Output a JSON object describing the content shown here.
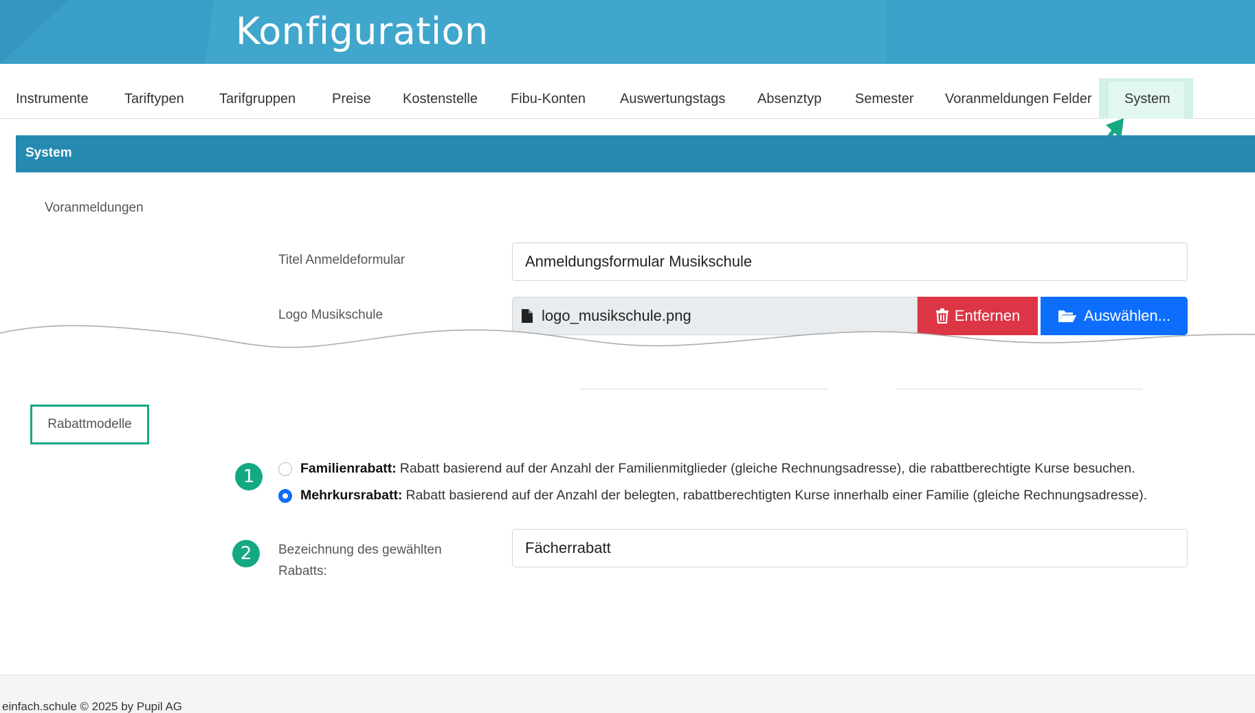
{
  "header": {
    "title": "Konfiguration"
  },
  "tabs": [
    {
      "label": "Instrumente"
    },
    {
      "label": "Tariftypen"
    },
    {
      "label": "Tarifgruppen"
    },
    {
      "label": "Preise"
    },
    {
      "label": "Kostenstelle"
    },
    {
      "label": "Fibu-Konten"
    },
    {
      "label": "Auswertungstags"
    },
    {
      "label": "Absenztyp"
    },
    {
      "label": "Semester"
    },
    {
      "label": "Voranmeldungen Felder"
    },
    {
      "label": "System",
      "active": true
    }
  ],
  "section": {
    "title": "System"
  },
  "voranmeldungen": {
    "heading": "Voranmeldungen",
    "titel_label": "Titel Anmeldeformular",
    "titel_value": "Anmeldungsformular Musikschule",
    "logo_label": "Logo Musikschule",
    "logo_file": "logo_musikschule.png",
    "remove_label": "Entfernen",
    "select_label": "Auswählen..."
  },
  "rabatt": {
    "heading": "Rabattmodelle",
    "badge1": "1",
    "badge2": "2",
    "options": [
      {
        "name": "Familienrabatt:",
        "desc": "Rabatt basierend auf der Anzahl der Familienmitglieder (gleiche Rechnungsadresse), die rabattberechtigte Kurse besuchen.",
        "checked": false
      },
      {
        "name": "Mehrkursrabatt:",
        "desc": "Rabatt basierend auf der Anzahl der belegten, rabattberechtigten Kurse innerhalb einer Familie (gleiche Rechnungsadresse).",
        "checked": true
      }
    ],
    "bezeichnung_label_line1": "Bezeichnung des gewählten",
    "bezeichnung_label_line2": "Rabatts:",
    "bezeichnung_value": "Fächerrabatt"
  },
  "footer": {
    "text": "einfach.schule © 2025 by Pupil AG"
  },
  "colors": {
    "banner": "#3a9fc6",
    "section_bar": "#2589b0",
    "accent_green": "#14a883",
    "danger": "#dc3545",
    "primary": "#0d6efd"
  },
  "icons": [
    "file-icon",
    "trash-icon",
    "folder-open-icon",
    "arrow-annotation-icon"
  ]
}
